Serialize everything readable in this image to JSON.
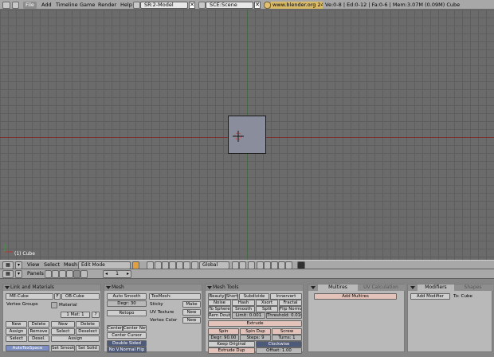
{
  "topbar": {
    "menus": [
      "File",
      "Add",
      "Timeline",
      "Game",
      "Render",
      "Help"
    ],
    "screen_field": "SR:2-Model",
    "scene_field": "SCE:Scene",
    "url": "www.blender.org 248.1",
    "stats": "Ve:0-8 | Ed:0-12 | Fa:0-6 | Mem:3.07M (0.09M) Cube"
  },
  "viewport": {
    "object_label": "(1) Cube"
  },
  "header3d": {
    "menus": [
      "View",
      "Select",
      "Mesh"
    ],
    "mode": "Edit Mode",
    "orientation": "Global"
  },
  "buttons_header": {
    "panels_label": "Panels",
    "frame": "1"
  },
  "link_panel": {
    "title": "Link and Materials",
    "me_field": "ME:Cube",
    "f_label": "F",
    "ob_field": "OB:Cube",
    "vertex_groups": "Vertex Groups",
    "material_label": "Material",
    "mat_count": "1 Mat: 1",
    "q_label": "?",
    "buttons_left": [
      "New",
      "Delete",
      "Assign",
      "Remove",
      "Select",
      "Desel."
    ],
    "buttons_right": [
      "New",
      "Delete",
      "Select",
      "Deselect"
    ],
    "assign": "Assign",
    "autotex": "AutoTexSpace",
    "set_smooth": "Set Smooth",
    "set_solid": "Set Solid"
  },
  "mesh_panel": {
    "title": "Mesh",
    "auto_smooth": "Auto Smooth",
    "degr": "Degr: 30",
    "retopo": "Retopo",
    "texmesh": "TexMesh:",
    "sticky": "Sticky",
    "make": "Make",
    "uv_texture": "UV Texture",
    "uv_new": "New",
    "vertex_color": "Vertex Color",
    "vc_new": "New",
    "center_new": "Center New",
    "center_cursor": "Center Cursor",
    "double_sided": "Double Sided",
    "no_vnormal": "No V.Normal Flip",
    "center": "Center"
  },
  "mesh_tools": {
    "title": "Mesh Tools",
    "row1": [
      "Beauty",
      "Short",
      "Subdivide",
      "Innervert"
    ],
    "row2": [
      "Noise",
      "Hash",
      "Xsort",
      "Fractal"
    ],
    "row3": [
      "To Sphere",
      "Smooth",
      "Split",
      "Flip Normals"
    ],
    "row4": [
      "Rem Doubles",
      "Limit: 0.001",
      "Threshold: 0.010"
    ],
    "extrude": "Extrude",
    "row6": [
      "Spin",
      "Spin Dup",
      "Screw"
    ],
    "row7": [
      "Degr: 90.00",
      "Steps: 9",
      "Turns: 1"
    ],
    "keep_original": "Keep Original",
    "clockwise": "Clockwise",
    "extrude_dup": "Extrude Dup",
    "offset": "Offset: 1.00"
  },
  "multires_panel": {
    "tab1": "Multires",
    "tab2": "UV Calculation",
    "add": "Add Multires"
  },
  "modifiers_panel": {
    "tab1": "Modifiers",
    "tab2": "Shapes",
    "add": "Add Modifier",
    "to": "To: Cube"
  },
  "colors": {
    "cube": "#8a8e9c",
    "active_button": "#7d8fc2",
    "pink_button": "#e3c3b9"
  }
}
